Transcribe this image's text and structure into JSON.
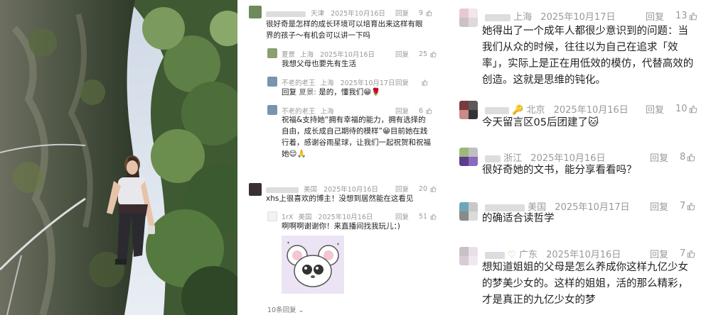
{
  "middle": {
    "comments": [
      {
        "location": "天津",
        "date": "2025年10月16日",
        "reply": "回复",
        "likes": "9",
        "text": "很好奇是怎样的成长环境可以培育出来这样有眼界的孩子～有机会可以讲一下吗"
      },
      {
        "user": "夏景",
        "location": "上海",
        "date": "2025年10月16日",
        "reply": "回复",
        "likes": "25",
        "text": "我想父母也要先有生活"
      },
      {
        "user": "不老的老王",
        "location": "上海",
        "date": "2025年10月17日",
        "reply": "回复",
        "text_prefix": "回复 ",
        "quote_user": "夏景:",
        "text": " 是的，懂我们😁🌹"
      },
      {
        "user": "不老的老王",
        "location": "上海",
        "reply": "回复",
        "likes": "6",
        "text": "祝福&支持她“拥有幸福的能力，拥有选择的自由，成长成自己期待的模样”😁目前她在践行着，感谢谷雨星球，让我们一起祝贺和祝福她😌🙏"
      },
      {
        "location": "美国",
        "date": "2025年10月16日",
        "reply": "回复",
        "likes": "20",
        "text": "xhs上很喜欢的博主！没想到居然能在这看见"
      },
      {
        "user": "1rX",
        "location": "美国",
        "date": "2025年10月16日",
        "reply": "回复",
        "likes": "51",
        "text": "啊啊啊谢谢你！来直播间找我玩儿：)"
      }
    ],
    "more_replies": "10条回复"
  },
  "right": {
    "comments": [
      {
        "location": "上海",
        "date": "2025年10月17日",
        "reply": "回复",
        "likes": "13",
        "text": "她得出了一个成年人都很少意识到的问题：当我们从众的时候，往往以为自己在追求「效率」，实际上是正在用低效的模仿，代替高效的创造。这就是思维的钝化。"
      },
      {
        "location": "北京",
        "date": "2025年10月16日",
        "reply": "回复",
        "likes": "10",
        "text": "今天留言区05后团建了🐱"
      },
      {
        "location": "浙江",
        "date": "2025年10月16日",
        "reply": "回复",
        "likes": "8",
        "text": "很好奇她的文书，能分享看看吗？"
      },
      {
        "location": "美国",
        "date": "2025年10月17日",
        "reply": "回复",
        "likes": "7",
        "text": "的确适合读哲学"
      },
      {
        "location": "广东",
        "date": "2025年10月16日",
        "reply": "回复",
        "likes": "7",
        "text": "想知道姐姐的父母是怎么养成你这样九亿少女的梦美少女的。这样的姐姐，活的那么精彩，才是真正的九亿少女的梦"
      }
    ]
  },
  "icons": {
    "like": "thumbs-up-icon",
    "expand": "chevron-down-icon"
  },
  "colors": {
    "meta_gray": "#999999",
    "text": "#222222"
  }
}
